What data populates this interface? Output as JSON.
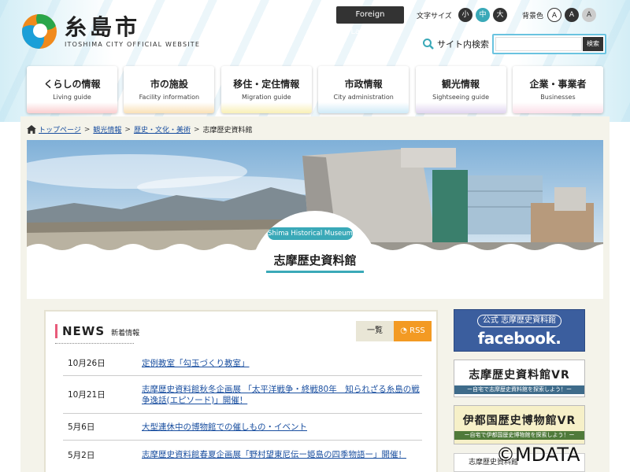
{
  "header": {
    "logo_name": "糸島市",
    "logo_sub": "ITOSHIMA CITY OFFICIAL WEBSITE",
    "foreign_language": "Foreign Language",
    "font_size_label": "文字サイズ",
    "font_sizes": [
      "小",
      "中",
      "大"
    ],
    "bg_color_label": "背景色",
    "bg_colors": [
      "A",
      "A",
      "A"
    ],
    "search_label": "サイト内検索",
    "search_placeholder": "",
    "search_button": "検索"
  },
  "nav": [
    {
      "main": "くらしの情報",
      "sub": "Living guide",
      "color": "#f6a6a8"
    },
    {
      "main": "市の施設",
      "sub": "Facility information",
      "color": "#f5c77b"
    },
    {
      "main": "移住・定住情報",
      "sub": "Migration guide",
      "color": "#f3e27b"
    },
    {
      "main": "市政情報",
      "sub": "City administration",
      "color": "#a8d8f0"
    },
    {
      "main": "観光情報",
      "sub": "Sightseeing guide",
      "color": "#c9b3e3"
    },
    {
      "main": "企業・事業者",
      "sub": "Businesses",
      "color": "#f7c4d6"
    }
  ],
  "breadcrumb": {
    "items": [
      "トップページ",
      "観光情報",
      "歴史・文化・美術",
      "志摩歴史資料館"
    ]
  },
  "hero": {
    "badge_en": "Shima Historical Museum",
    "badge_jp": "志摩歴史資料館",
    "accent": "#3aa9b8"
  },
  "news": {
    "title": "NEWS",
    "subtitle": "新着情報",
    "list_button": "一覧",
    "rss_button": "RSS",
    "items": [
      {
        "date": "10月26日",
        "text": "定例教室「勾玉づくり教室」"
      },
      {
        "date": "10月21日",
        "text": "志摩歴史資料館秋冬企画展 「太平洋戦争・終戦80年　知られざる糸島の戦争逸話(エピソード)」開催！"
      },
      {
        "date": "5月6日",
        "text": "大型連休中の博物館での催しもの・イベント"
      },
      {
        "date": "5月2日",
        "text": "志摩歴史資料館春夏企画展「野村望東尼伝ー姫島の四季物語ー」開催！"
      }
    ]
  },
  "sidebar": {
    "facebook_top": "公式 志摩歴史資料館",
    "facebook_main": "facebook.",
    "vr1_title": "志摩歴史資料館VR",
    "vr1_sub": "ー自宅で志摩歴史資料館を探索しよう！ー",
    "vr2_title": "伊都国歴史博物館VR",
    "vr2_sub": "ー自宅で伊都国歴史博物館を探索しよう！ー",
    "link_text": "志摩歴史資料館"
  },
  "watermark": "©MDATA"
}
